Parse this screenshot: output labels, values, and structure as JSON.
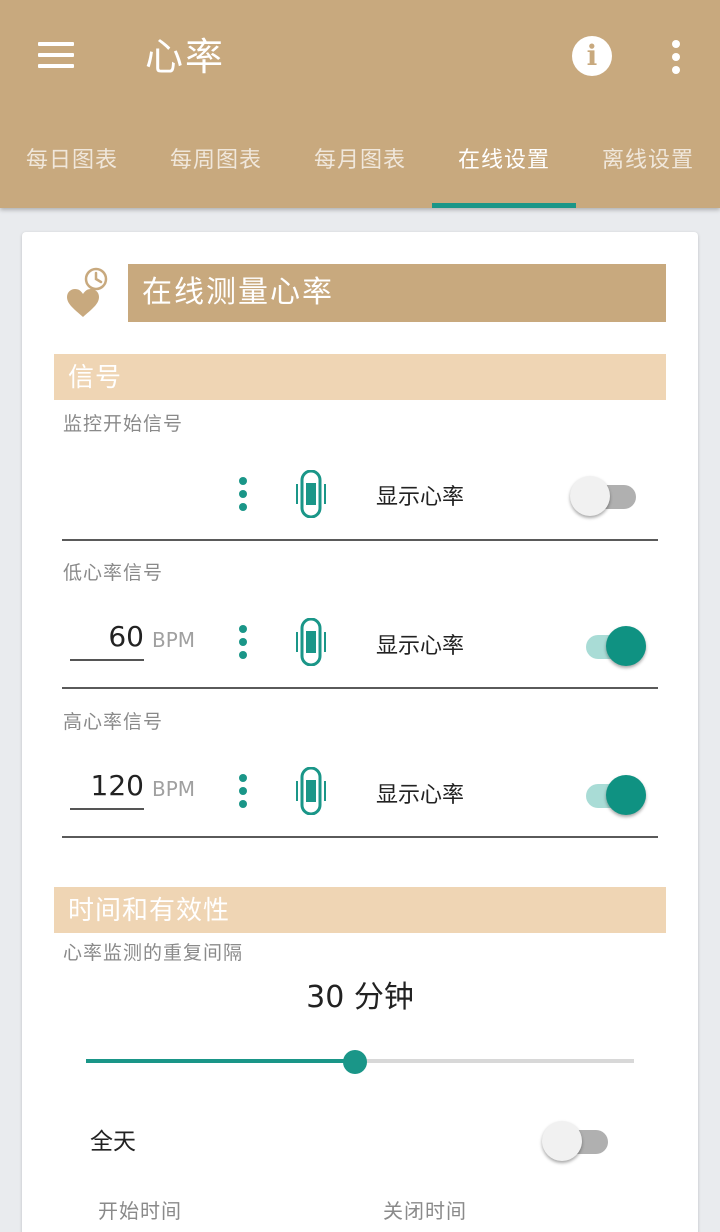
{
  "appbar": {
    "title": "心率",
    "info_glyph": "i"
  },
  "tabs": [
    {
      "label": "每日图表",
      "active": false
    },
    {
      "label": "每周图表",
      "active": false
    },
    {
      "label": "每月图表",
      "active": false
    },
    {
      "label": "在线设置",
      "active": true
    },
    {
      "label": "离线设置",
      "active": false
    }
  ],
  "card": {
    "title": "在线测量心率",
    "icon": "heart-clock-icon"
  },
  "signals": {
    "header": "信号",
    "start": {
      "label": "监控开始信号",
      "show_label": "显示心率",
      "toggle_on": false
    },
    "low": {
      "label": "低心率信号",
      "value": "60",
      "unit": "BPM",
      "show_label": "显示心率",
      "toggle_on": true
    },
    "high": {
      "label": "高心率信号",
      "value": "120",
      "unit": "BPM",
      "show_label": "显示心率",
      "toggle_on": true
    }
  },
  "timing": {
    "header": "时间和有效性",
    "interval_label": "心率监测的重复间隔",
    "interval_value": "30 分钟",
    "slider_fraction": 0.49,
    "allday_label": "全天",
    "allday_on": false,
    "start_time_label": "开始时间",
    "end_time_label": "关闭时间"
  },
  "colors": {
    "brand": "#c8a97e",
    "accent": "#1a9688",
    "header_tint": "#efd5b4"
  }
}
